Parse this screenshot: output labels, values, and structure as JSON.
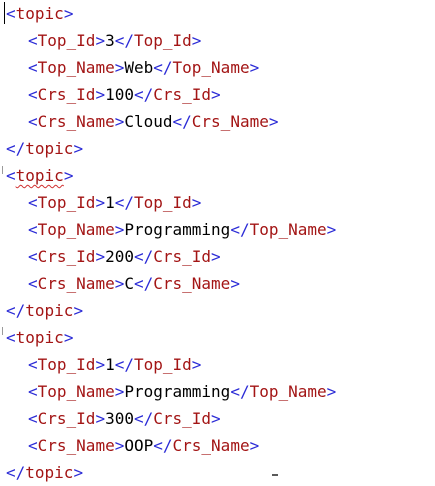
{
  "editor": {
    "lines": [
      {
        "indent": 0,
        "kind": "open",
        "tag": "topic"
      },
      {
        "indent": 1,
        "kind": "elem",
        "tag": "Top_Id",
        "value": "3"
      },
      {
        "indent": 1,
        "kind": "elem",
        "tag": "Top_Name",
        "value": "Web"
      },
      {
        "indent": 1,
        "kind": "elem",
        "tag": "Crs_Id",
        "value": "100"
      },
      {
        "indent": 1,
        "kind": "elem",
        "tag": "Crs_Name",
        "value": "Cloud"
      },
      {
        "indent": 0,
        "kind": "close",
        "tag": "topic"
      },
      {
        "indent": 0,
        "kind": "open",
        "tag": "topic",
        "squiggle": true
      },
      {
        "indent": 1,
        "kind": "elem",
        "tag": "Top_Id",
        "value": "1"
      },
      {
        "indent": 1,
        "kind": "elem",
        "tag": "Top_Name",
        "value": "Programming"
      },
      {
        "indent": 1,
        "kind": "elem",
        "tag": "Crs_Id",
        "value": "200"
      },
      {
        "indent": 1,
        "kind": "elem",
        "tag": "Crs_Name",
        "value": "C"
      },
      {
        "indent": 0,
        "kind": "close",
        "tag": "topic"
      },
      {
        "indent": 0,
        "kind": "open",
        "tag": "topic"
      },
      {
        "indent": 1,
        "kind": "elem",
        "tag": "Top_Id",
        "value": "1"
      },
      {
        "indent": 1,
        "kind": "elem",
        "tag": "Top_Name",
        "value": "Programming"
      },
      {
        "indent": 1,
        "kind": "elem",
        "tag": "Crs_Id",
        "value": "300"
      },
      {
        "indent": 1,
        "kind": "elem",
        "tag": "Crs_Name",
        "value": "OOP"
      },
      {
        "indent": 0,
        "kind": "close",
        "tag": "topic"
      }
    ]
  },
  "colors": {
    "bracket": "#2b2bd6",
    "tag_name": "#a31515",
    "text": "#000000",
    "squiggle": "#d03030",
    "background": "#ffffff"
  }
}
